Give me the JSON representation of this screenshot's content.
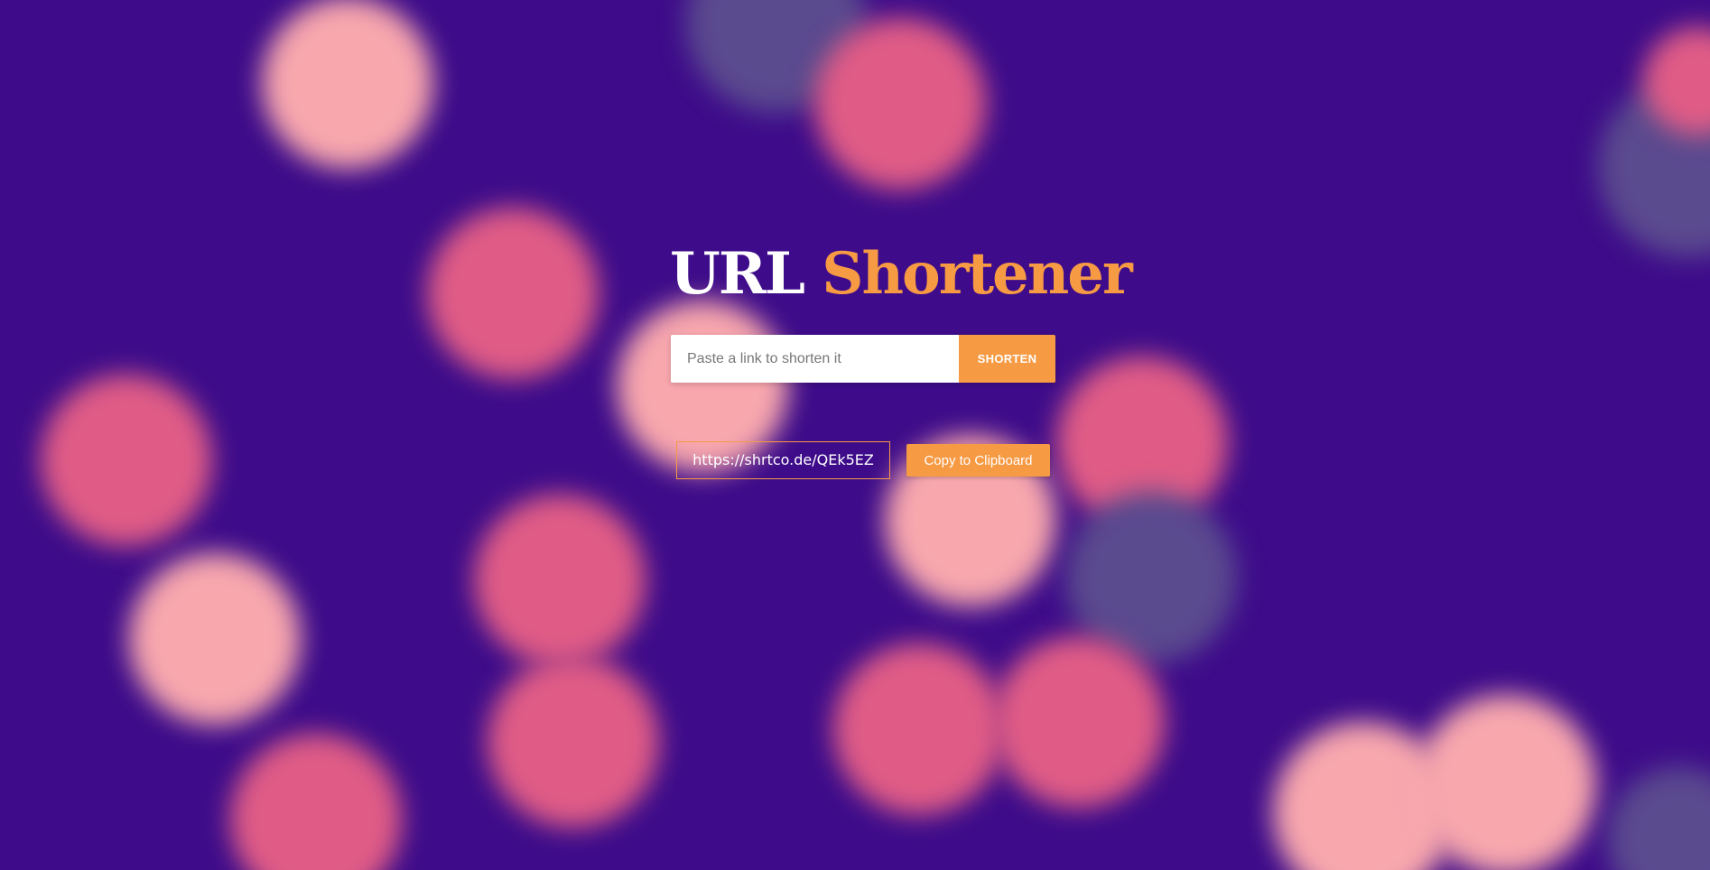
{
  "page": {
    "background_color": "#3e0c8a",
    "accent_color": "#f79a44"
  },
  "header": {
    "title_part1": "URL",
    "title_part2": "Shortener"
  },
  "form": {
    "input_placeholder": "Paste a link to shorten it",
    "input_value": "",
    "submit_label": "SHORTEN"
  },
  "result": {
    "short_url": "https://shrtco.de/QEk5EZ",
    "copy_label": "Copy to Clipboard"
  }
}
